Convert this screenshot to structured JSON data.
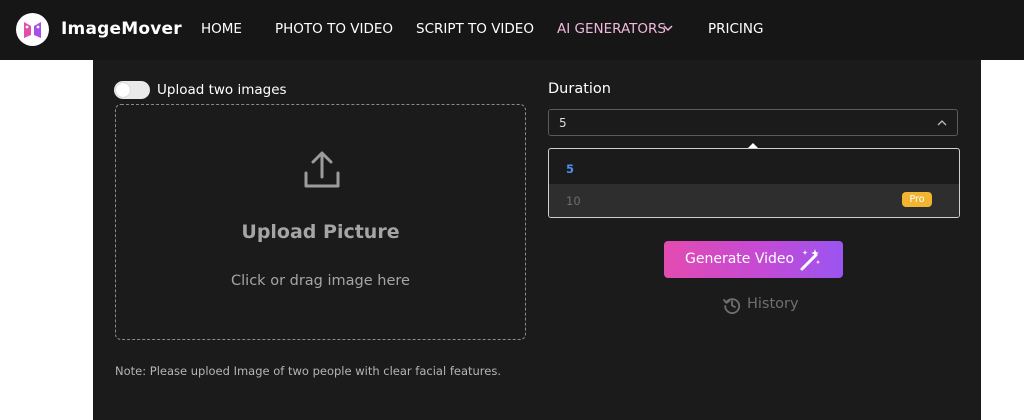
{
  "navbar": {
    "brand": "ImageMover",
    "items": [
      {
        "label": "HOME"
      },
      {
        "label": "PHOTO TO VIDEO"
      },
      {
        "label": "SCRIPT TO VIDEO"
      },
      {
        "label": "AI GENERATORS"
      },
      {
        "label": "PRICING"
      }
    ],
    "ai_generators_color": "#f0b8df"
  },
  "upload": {
    "toggle_label": "Upload two images",
    "toggle_on": false,
    "title": "Upload Picture",
    "subtitle": "Click or drag image here",
    "note": "Note: Please uploed Image of two people with clear facial features."
  },
  "duration": {
    "label": "Duration",
    "selected": "5",
    "options": [
      {
        "label": "5",
        "selected": true
      },
      {
        "label": "10",
        "badge": "Pro"
      }
    ]
  },
  "actions": {
    "generate_label": "Generate Video",
    "history_label": "History"
  },
  "icons": {
    "logo": "imagemover-logo-icon",
    "nav_chevron": "chevron-down-icon",
    "upload": "upload-icon",
    "select_chevron": "chevron-up-icon",
    "generate": "magic-wand-icon",
    "history": "history-icon"
  },
  "colors": {
    "navbar_bg": "#161616",
    "panel_bg": "#1b1b1b",
    "selected_option": "#4d8ff5",
    "pro_badge": "#f2b531",
    "generate_gradient_start": "#e34bb0",
    "generate_gradient_end": "#9a55f0"
  }
}
